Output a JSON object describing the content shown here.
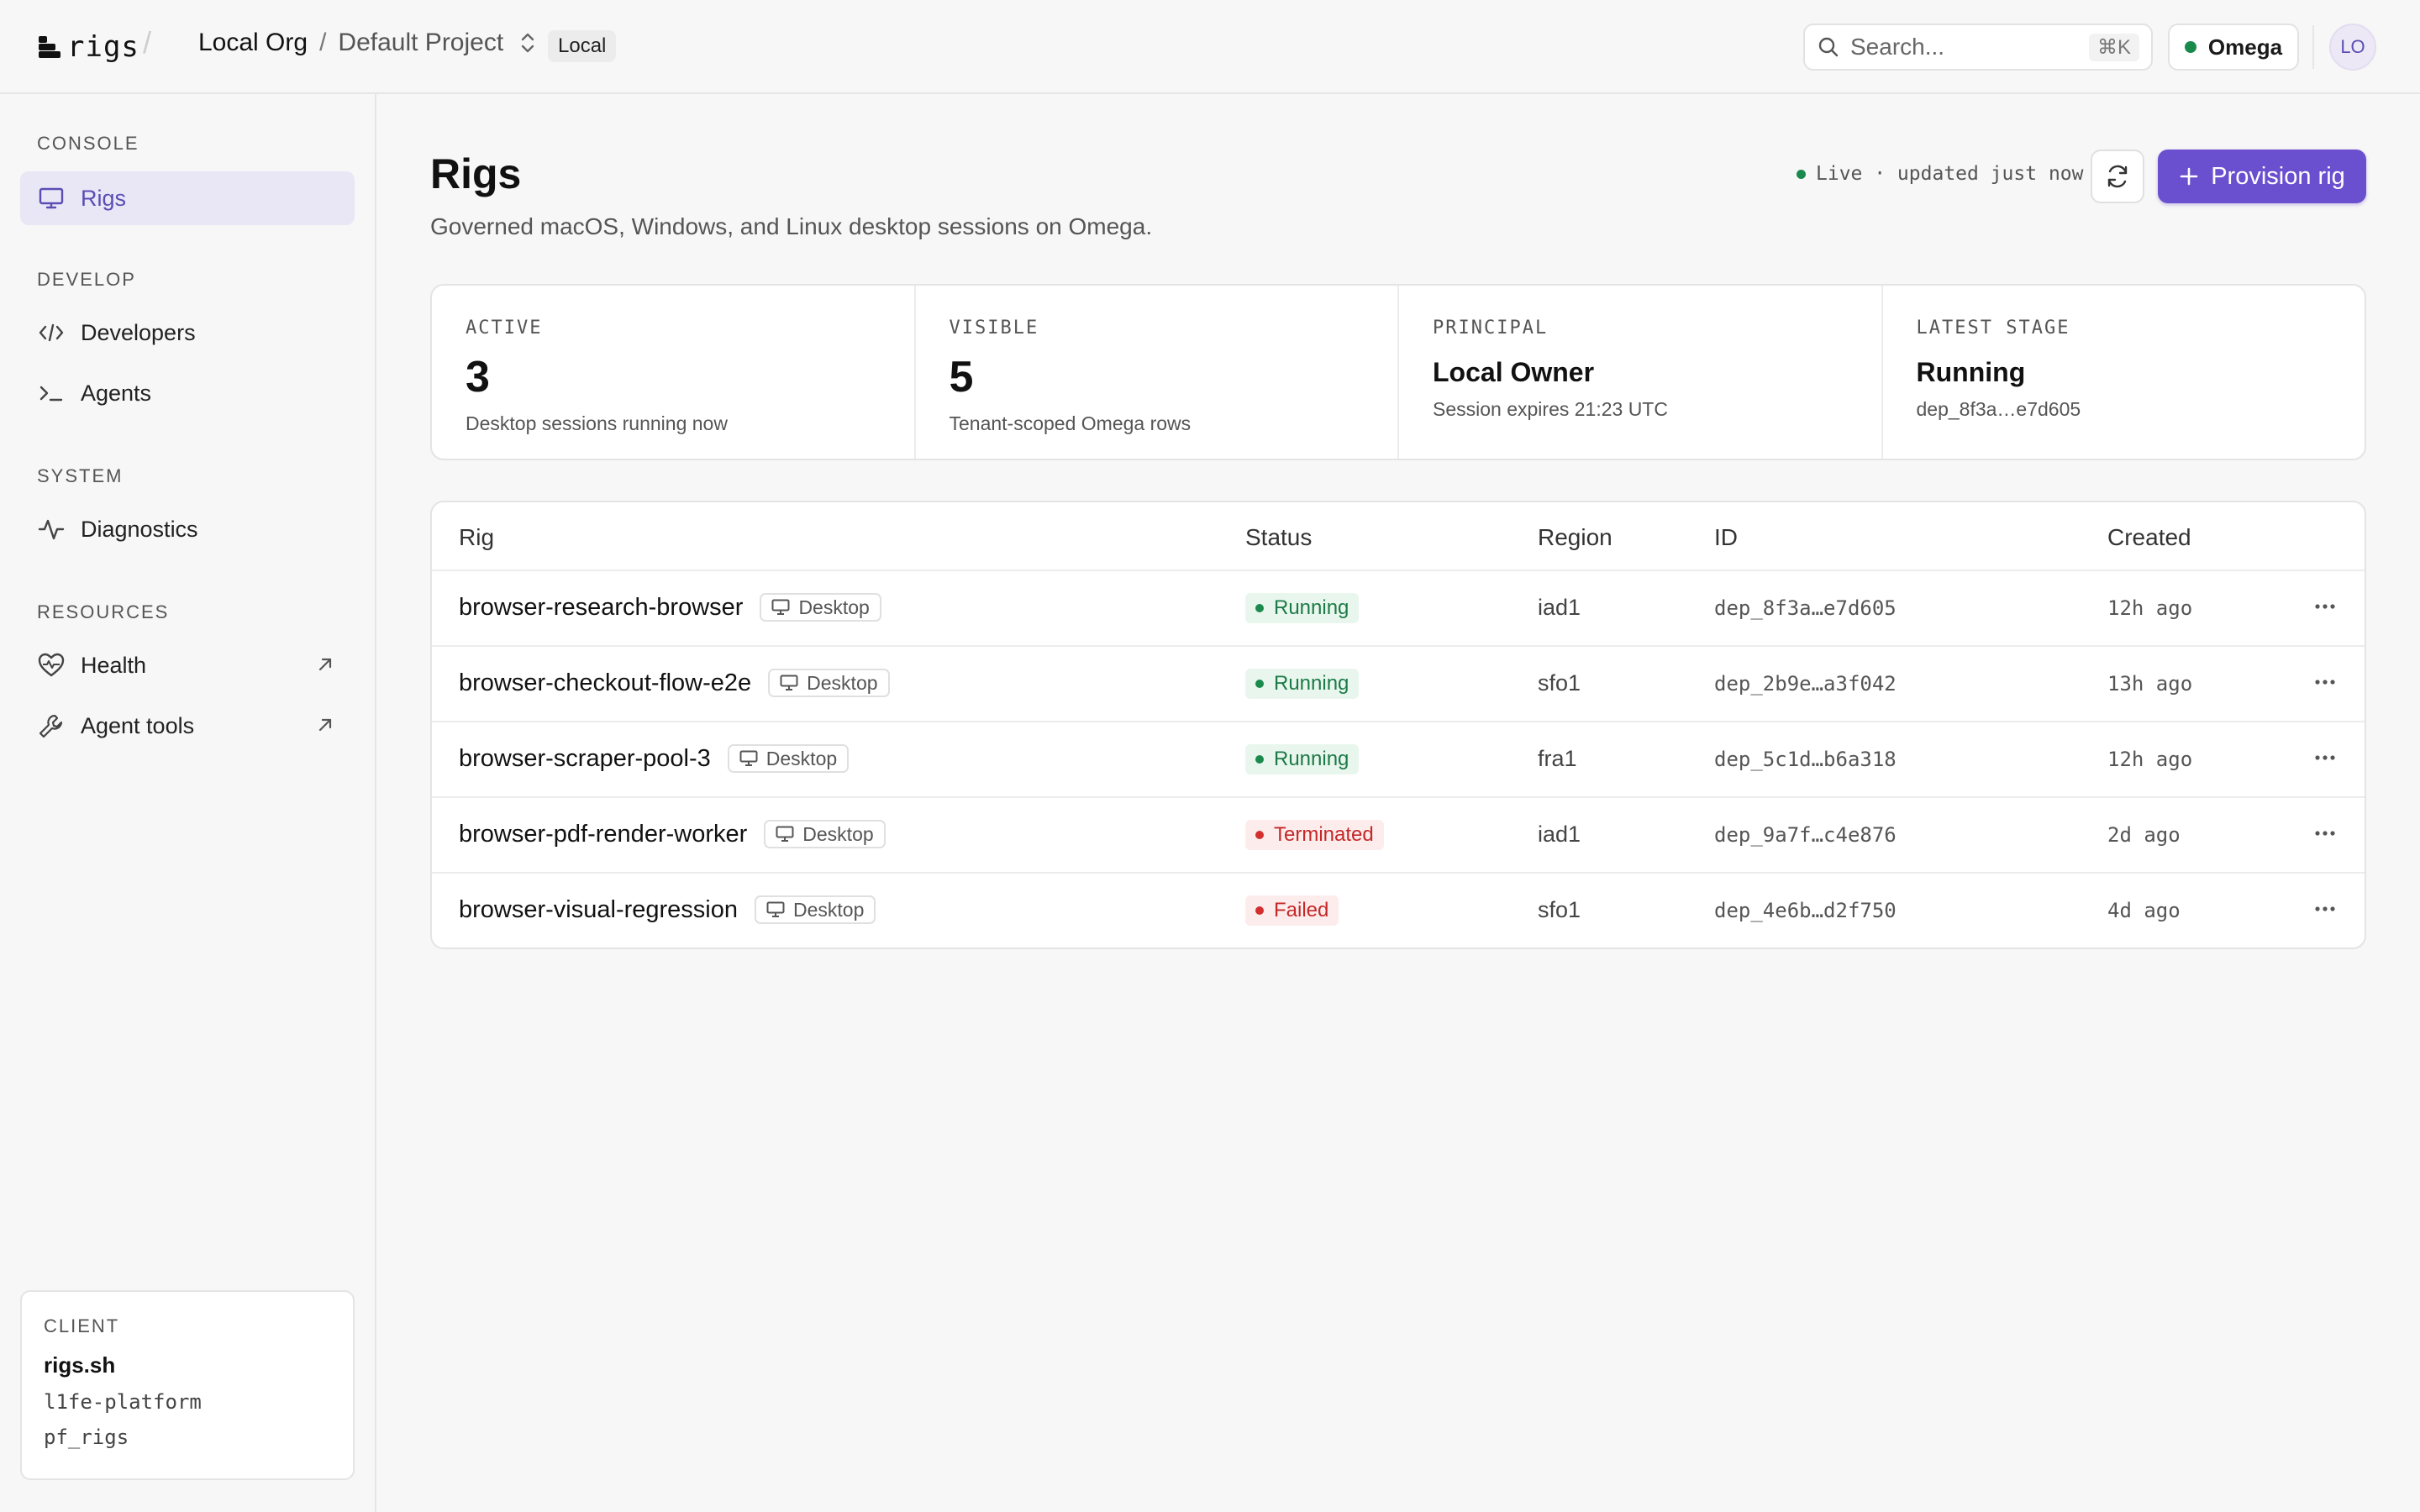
{
  "app": {
    "logo_text": "rigs"
  },
  "topbar": {
    "org": "Local Org",
    "separator": "/",
    "project": "Default Project",
    "env_badge": "Local",
    "search_placeholder": "Search...",
    "search_shortcut": "⌘K",
    "current_org": "Omega",
    "avatar_initials": "LO"
  },
  "sidebar": {
    "sections": {
      "console": "CONSOLE",
      "develop": "DEVELOP",
      "system": "SYSTEM",
      "resources": "RESOURCES"
    },
    "items": {
      "rigs": "Rigs",
      "developers": "Developers",
      "agents": "Agents",
      "diagnostics": "Diagnostics",
      "health": "Health",
      "agent_tools": "Agent tools"
    },
    "client": {
      "label": "CLIENT",
      "name": "rigs.sh",
      "line1": "l1fe-platform",
      "line2": "pf_rigs"
    }
  },
  "page": {
    "title": "Rigs",
    "subtitle": "Governed macOS, Windows, and Linux desktop sessions on Omega.",
    "live_status": "Live · updated just now",
    "provision_label": "Provision rig"
  },
  "stats": [
    {
      "label": "ACTIVE",
      "value": "3",
      "note": "Desktop sessions running now"
    },
    {
      "label": "VISIBLE",
      "value": "5",
      "note": "Tenant-scoped Omega rows"
    },
    {
      "label": "PRINCIPAL",
      "value": "Local Owner",
      "note": "Session expires 21:23 UTC"
    },
    {
      "label": "LATEST STAGE",
      "value": "Running",
      "note": "dep_8f3a…e7d605"
    }
  ],
  "table": {
    "columns": {
      "rig": "Rig",
      "status": "Status",
      "region": "Region",
      "id": "ID",
      "created": "Created"
    },
    "rows": [
      {
        "name": "browser-research-browser",
        "type": "Desktop",
        "status": "Running",
        "region": "iad1",
        "id": "dep_8f3a…e7d605",
        "created": "12h ago"
      },
      {
        "name": "browser-checkout-flow-e2e",
        "type": "Desktop",
        "status": "Running",
        "region": "sfo1",
        "id": "dep_2b9e…a3f042",
        "created": "13h ago"
      },
      {
        "name": "browser-scraper-pool-3",
        "type": "Desktop",
        "status": "Running",
        "region": "fra1",
        "id": "dep_5c1d…b6a318",
        "created": "12h ago"
      },
      {
        "name": "browser-pdf-render-worker",
        "type": "Desktop",
        "status": "Terminated",
        "region": "iad1",
        "id": "dep_9a7f…c4e876",
        "created": "2d ago"
      },
      {
        "name": "browser-visual-regression",
        "type": "Desktop",
        "status": "Failed",
        "region": "sfo1",
        "id": "dep_4e6b…d2f750",
        "created": "4d ago"
      }
    ]
  },
  "colors": {
    "accent": "#6a4fcf",
    "running": "#1b8a4c",
    "failed": "#d32f2f"
  }
}
